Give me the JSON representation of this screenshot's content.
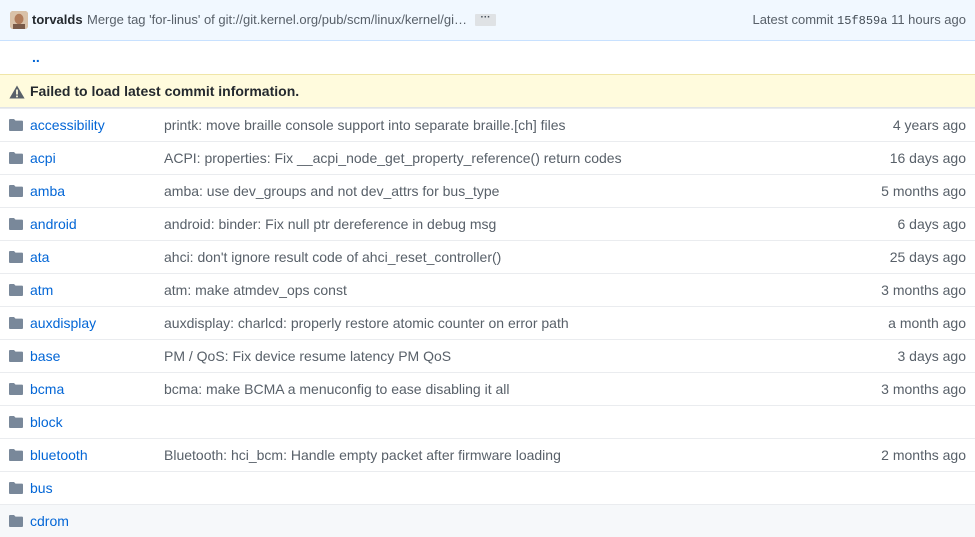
{
  "commit_bar": {
    "author": "torvalds",
    "message": "Merge tag 'for-linus' of git://git.kernel.org/pub/scm/linux/kernel/gi…",
    "ellipsis": "···",
    "latest_label": "Latest commit",
    "sha": "15f859a",
    "age": "11 hours ago"
  },
  "up_link": "..",
  "warning": "Failed to load latest commit information.",
  "files": [
    {
      "name": "accessibility",
      "message": "printk: move braille console support into separate braille.[ch] files",
      "age": "4 years ago"
    },
    {
      "name": "acpi",
      "message": "ACPI: properties: Fix __acpi_node_get_property_reference() return codes",
      "age": "16 days ago"
    },
    {
      "name": "amba",
      "message": "amba: use dev_groups and not dev_attrs for bus_type",
      "age": "5 months ago"
    },
    {
      "name": "android",
      "message": "android: binder: Fix null ptr dereference in debug msg",
      "age": "6 days ago"
    },
    {
      "name": "ata",
      "message": "ahci: don't ignore result code of ahci_reset_controller()",
      "age": "25 days ago"
    },
    {
      "name": "atm",
      "message": "atm: make atmdev_ops const",
      "age": "3 months ago"
    },
    {
      "name": "auxdisplay",
      "message": "auxdisplay: charlcd: properly restore atomic counter on error path",
      "age": "a month ago"
    },
    {
      "name": "base",
      "message": "PM / QoS: Fix device resume latency PM QoS",
      "age": "3 days ago"
    },
    {
      "name": "bcma",
      "message": "bcma: make BCMA a menuconfig to ease disabling it all",
      "age": "3 months ago"
    },
    {
      "name": "block",
      "message": "",
      "age": ""
    },
    {
      "name": "bluetooth",
      "message": "Bluetooth: hci_bcm: Handle empty packet after firmware loading",
      "age": "2 months ago"
    },
    {
      "name": "bus",
      "message": "",
      "age": ""
    },
    {
      "name": "cdrom",
      "message": "",
      "age": ""
    }
  ],
  "colors": {
    "link": "#0366d6",
    "muted": "#586069",
    "folder": "#79889a",
    "warning_bg": "#fffbdd",
    "commit_bar_bg": "#f1f8ff"
  },
  "icons": {
    "folder": "folder-icon",
    "warning": "alert-icon",
    "avatar": "user-avatar"
  }
}
